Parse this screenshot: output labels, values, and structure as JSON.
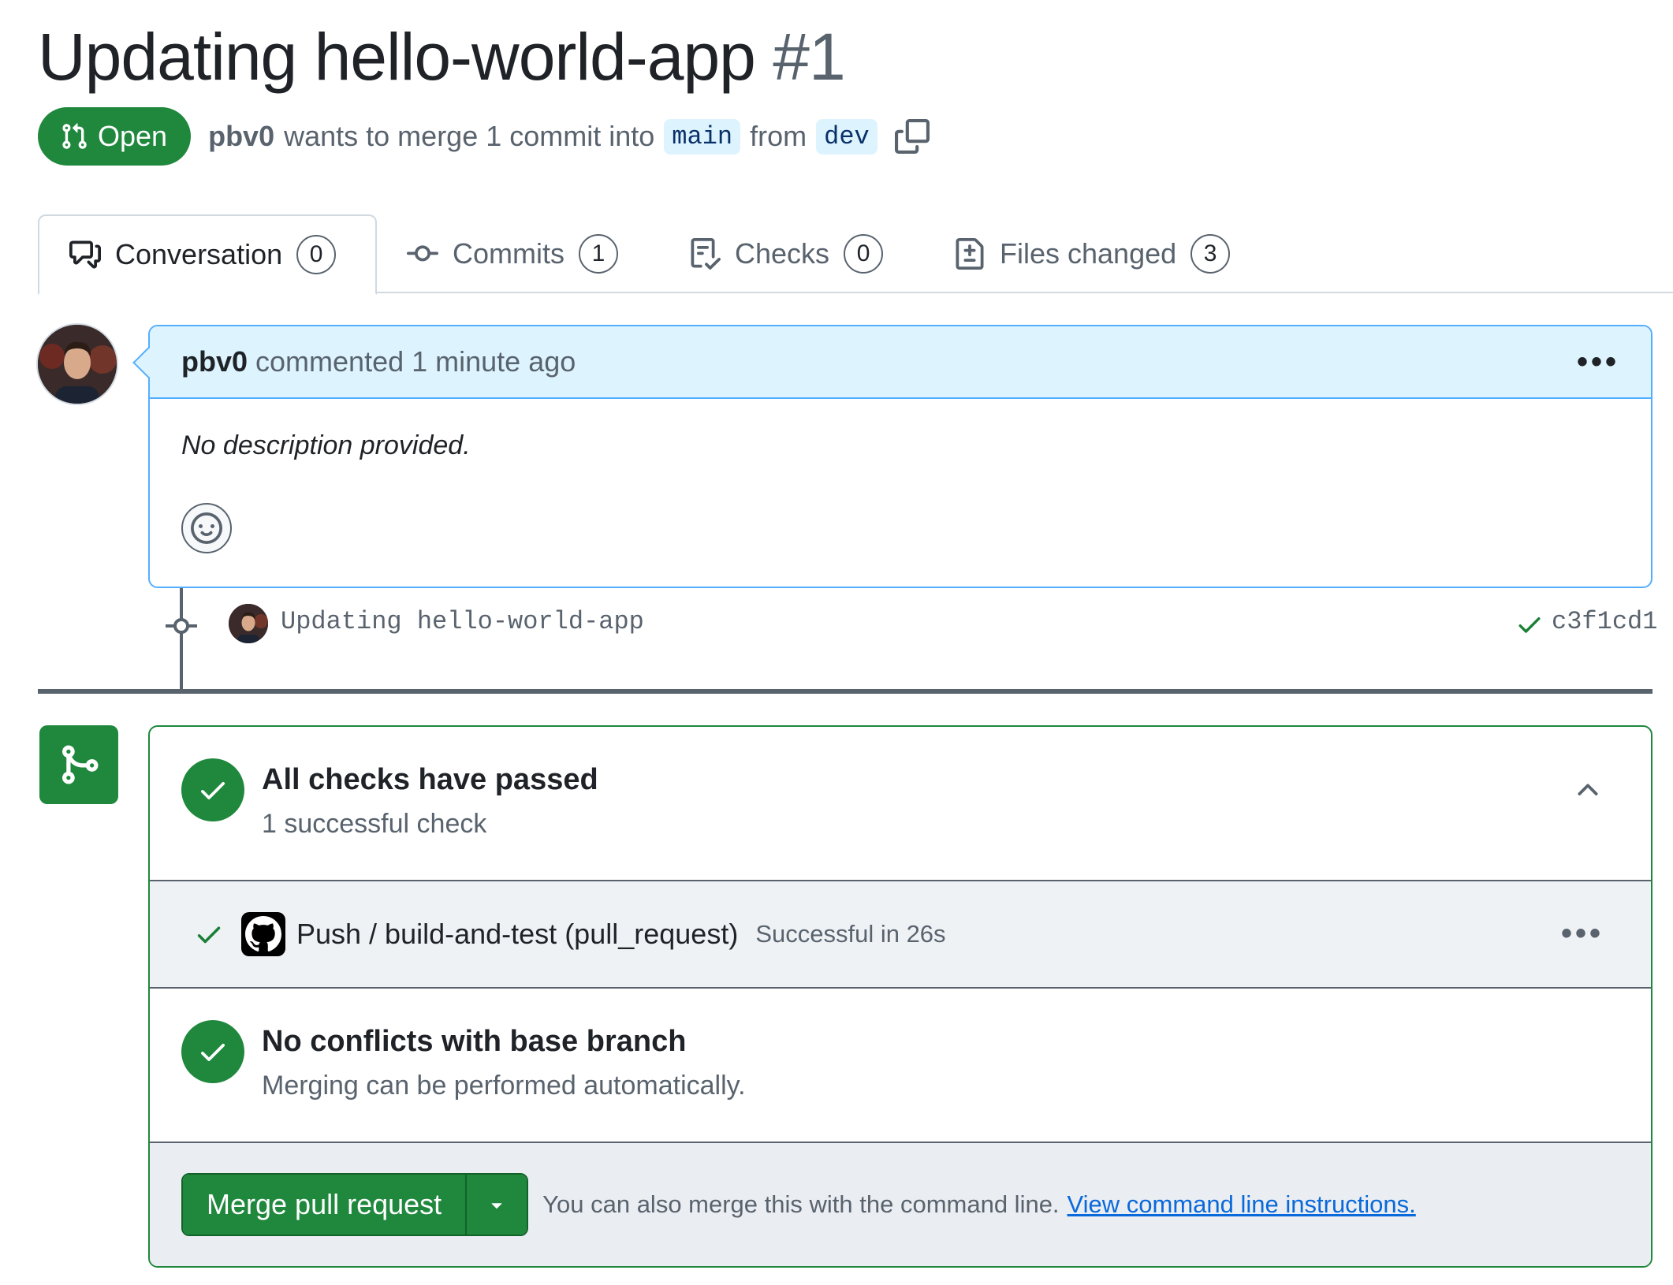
{
  "pr": {
    "title": "Updating hello-world-app",
    "number": "#1",
    "state_label": "Open",
    "author": "pbv0",
    "merge_text_1": "wants to merge 1 commit into",
    "base_branch": "main",
    "merge_text_2": "from",
    "head_branch": "dev"
  },
  "tabs": [
    {
      "label": "Conversation",
      "count": "0",
      "icon": "comment-discussion-icon"
    },
    {
      "label": "Commits",
      "count": "1",
      "icon": "git-commit-icon"
    },
    {
      "label": "Checks",
      "count": "0",
      "icon": "checklist-icon"
    },
    {
      "label": "Files changed",
      "count": "3",
      "icon": "file-diff-icon"
    }
  ],
  "comment": {
    "author": "pbv0",
    "meta": "commented 1 minute ago",
    "body": "No description provided."
  },
  "commit": {
    "message": "Updating hello-world-app",
    "sha": "c3f1cd1"
  },
  "checks": {
    "title": "All checks have passed",
    "subtitle": "1 successful check",
    "run_name": "Push / build-and-test (pull_request)",
    "run_status": "Successful in 26s"
  },
  "conflicts": {
    "title": "No conflicts with base branch",
    "subtitle": "Merging can be performed automatically."
  },
  "merge": {
    "button_label": "Merge pull request",
    "hint": "You can also merge this with the command line.",
    "link": "View command line instructions."
  },
  "colors": {
    "success": "#1f883d",
    "accent_blue": "#0969da",
    "comment_header_bg": "#ddf4ff",
    "muted_text": "#59636e"
  }
}
